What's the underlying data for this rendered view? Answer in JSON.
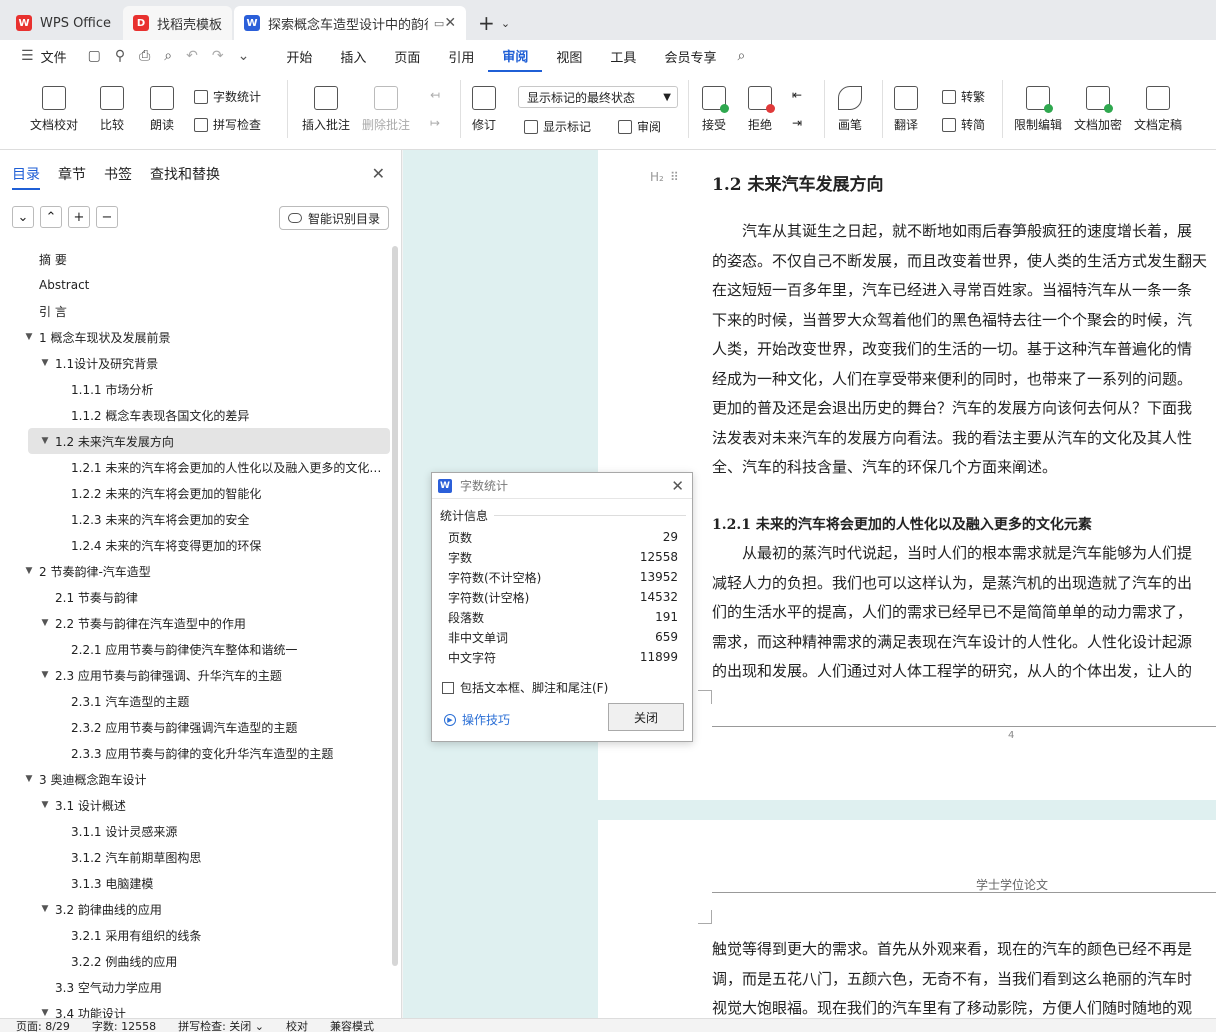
{
  "tabs": [
    {
      "label": "WPS Office",
      "logo_color": "#e8312f"
    },
    {
      "label": "找稻壳模板",
      "logo_color": "#e8312f"
    },
    {
      "label": "探索概念车造型设计中的韵律",
      "logo_color": "#2b5fd9",
      "logo_letter": "W"
    }
  ],
  "menu": {
    "file": "文件",
    "items": [
      "开始",
      "插入",
      "页面",
      "引用",
      "审阅",
      "视图",
      "工具",
      "会员专享"
    ],
    "active": "审阅"
  },
  "ribbon": {
    "doc_check": "文档校对",
    "compare": "比较",
    "read_aloud": "朗读",
    "word_count": "字数统计",
    "spell_check": "拼写检查",
    "insert_comment": "插入批注",
    "delete_comment": "删除批注",
    "track_changes": "修订",
    "markup_state": "显示标记的最终状态",
    "show_markup": "显示标记",
    "review": "审阅",
    "accept": "接受",
    "reject": "拒绝",
    "pen": "画笔",
    "translate": "翻译",
    "to_traditional": "转繁",
    "to_simplified": "转简",
    "restrict_edit": "限制编辑",
    "encrypt": "文档加密",
    "finalize": "文档定稿"
  },
  "left_panel": {
    "tabs": [
      "目录",
      "章节",
      "书签",
      "查找和替换"
    ],
    "smart_toc": "智能识别目录",
    "toc": [
      {
        "level": 0,
        "text": "摘 要",
        "arrow": ""
      },
      {
        "level": 0,
        "text": "Abstract",
        "arrow": ""
      },
      {
        "level": 0,
        "text": "引 言",
        "arrow": ""
      },
      {
        "level": 0,
        "text": "1 概念车现状及发展前景",
        "arrow": "▼"
      },
      {
        "level": 1,
        "text": "1.1设计及研究背景",
        "arrow": "▼"
      },
      {
        "level": 2,
        "text": "1.1.1 市场分析",
        "arrow": ""
      },
      {
        "level": 2,
        "text": "1.1.2 概念车表现各国文化的差异",
        "arrow": ""
      },
      {
        "level": 1,
        "text": "1.2 未来汽车发展方向",
        "arrow": "▼",
        "selected": true
      },
      {
        "level": 2,
        "text": "1.2.1 未来的汽车将会更加的人性化以及融入更多的文化…",
        "arrow": ""
      },
      {
        "level": 2,
        "text": "1.2.2 未来的汽车将会更加的智能化",
        "arrow": ""
      },
      {
        "level": 2,
        "text": "1.2.3 未来的汽车将会更加的安全",
        "arrow": ""
      },
      {
        "level": 2,
        "text": "1.2.4 未来的汽车将变得更加的环保",
        "arrow": ""
      },
      {
        "level": 0,
        "text": "2 节奏韵律-汽车造型",
        "arrow": "▼"
      },
      {
        "level": 1,
        "text": "2.1 节奏与韵律",
        "arrow": ""
      },
      {
        "level": 1,
        "text": "2.2 节奏与韵律在汽车造型中的作用",
        "arrow": "▼"
      },
      {
        "level": 2,
        "text": "2.2.1 应用节奏与韵律使汽车整体和谐统一",
        "arrow": ""
      },
      {
        "level": 1,
        "text": "2.3 应用节奏与韵律强调、升华汽车的主题",
        "arrow": "▼"
      },
      {
        "level": 2,
        "text": "2.3.1 汽车造型的主题",
        "arrow": ""
      },
      {
        "level": 2,
        "text": "2.3.2 应用节奏与韵律强调汽车造型的主题",
        "arrow": ""
      },
      {
        "level": 2,
        "text": "2.3.3 应用节奏与韵律的变化升华汽车造型的主题",
        "arrow": ""
      },
      {
        "level": 0,
        "text": "3 奥迪概念跑车设计",
        "arrow": "▼"
      },
      {
        "level": 1,
        "text": "3.1 设计概述",
        "arrow": "▼"
      },
      {
        "level": 2,
        "text": "3.1.1 设计灵感来源",
        "arrow": ""
      },
      {
        "level": 2,
        "text": "3.1.2 汽车前期草图构思",
        "arrow": ""
      },
      {
        "level": 2,
        "text": "3.1.3 电脑建模",
        "arrow": ""
      },
      {
        "level": 1,
        "text": "3.2 韵律曲线的应用",
        "arrow": "▼"
      },
      {
        "level": 2,
        "text": "3.2.1 采用有组织的线条",
        "arrow": ""
      },
      {
        "level": 2,
        "text": "3.2.2 例曲线的应用",
        "arrow": ""
      },
      {
        "level": 1,
        "text": "3.3 空气动力学应用",
        "arrow": ""
      },
      {
        "level": 1,
        "text": "3.4 功能设计",
        "arrow": "▼"
      }
    ]
  },
  "document": {
    "page1": {
      "heading_mark": "H₂",
      "heading": "1.2  未来汽车发展方向",
      "para1": [
        "汽车从其诞生之日起，就不断地如雨后春笋般疯狂的速度增长着，展",
        "的姿态。不仅自己不断发展，而且改变着世界，使人类的生活方式发生翻天",
        "在这短短一百多年里，汽车已经进入寻常百姓家。当福特汽车从一条一条",
        "下来的时候，当普罗大众驾着他们的黑色福特去往一个个聚会的时候，汽",
        "人类，开始改变世界，改变我们的生活的一切。基于这种汽车普遍化的情",
        "经成为一种文化，人们在享受带来便利的同时，也带来了一系列的问题。",
        "更加的普及还是会退出历史的舞台？汽车的发展方向该何去何从？下面我",
        "法发表对未来汽车的发展方向看法。我的看法主要从汽车的文化及其人性",
        "全、汽车的科技含量、汽车的环保几个方面来阐述。"
      ],
      "subheading": "1.2.1 未来的汽车将会更加的人性化以及融入更多的文化元素",
      "para2": [
        "从最初的蒸汽时代说起，当时人们的根本需求就是汽车能够为人们提",
        "减轻人力的负担。我们也可以这样认为，是蒸汽机的出现造就了汽车的出",
        "们的生活水平的提高，人们的需求已经早已不是简简单单的动力需求了，",
        "需求，而这种精神需求的满足表现在汽车设计的人性化。人性化设计起源",
        "的出现和发展。人们通过对人体工程学的研究，从人的个体出发，让人的"
      ],
      "page_number": "4"
    },
    "page2": {
      "header": "学士学位论文",
      "lines": [
        "触觉等得到更大的需求。首先从外观来看，现在的汽车的颜色已经不再是",
        "调，而是五花八门，五颜六色，无奇不有，当我们看到这么艳丽的汽车时",
        "视觉大饱眼福。现在我们的汽车里有了移动影院，方便人们随时随地的观"
      ]
    }
  },
  "dialog": {
    "title": "字数统计",
    "section": "统计信息",
    "stats": [
      {
        "label": "页数",
        "value": "29"
      },
      {
        "label": "字数",
        "value": "12558"
      },
      {
        "label": "字符数(不计空格)",
        "value": "13952"
      },
      {
        "label": "字符数(计空格)",
        "value": "14532"
      },
      {
        "label": "段落数",
        "value": "191"
      },
      {
        "label": "非中文单词",
        "value": "659"
      },
      {
        "label": "中文字符",
        "value": "11899"
      }
    ],
    "checkbox_label": "包括文本框、脚注和尾注(F)",
    "tips": "操作技巧",
    "close": "关闭"
  },
  "statusbar": {
    "page": "页面: 8/29",
    "words": "字数: 12558",
    "spell": "拼写检查: 关闭 ⌄",
    "proof": "校对",
    "compat": "兼容模式"
  },
  "colors": {
    "accent": "#1f5fd6",
    "doc_bg": "#dff0f0"
  }
}
